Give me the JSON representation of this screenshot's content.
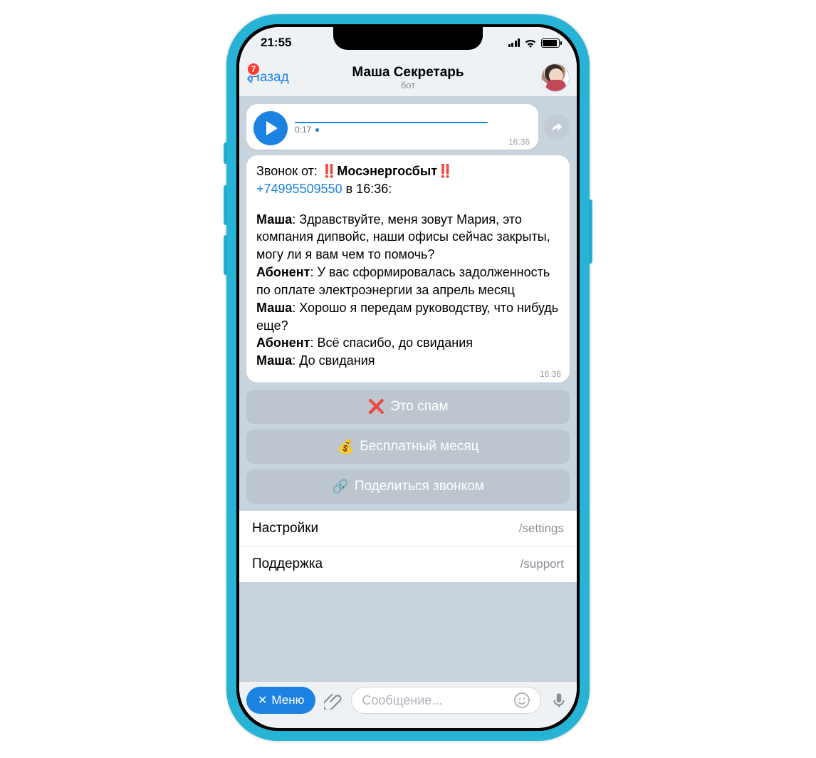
{
  "statusbar": {
    "time": "21:55"
  },
  "navbar": {
    "back_label": "Назад",
    "badge_count": "7",
    "title": "Маша Секретарь",
    "subtitle": "бот"
  },
  "voice_message": {
    "duration": "0:17",
    "time": "16:36"
  },
  "call_transcript": {
    "header_prefix": "Звонок от: ",
    "caller_name": "Мосэнергосбыт",
    "phone": "+74995509550",
    "at_word": " в ",
    "call_time": "16:36",
    "msg_time": "16:36",
    "lines": [
      {
        "speaker": "Маша",
        "text": "Здравствуйте, меня зовут Мария, это компания дипвойс, наши офисы сейчас закрыты, могу ли я вам чем то помочь?"
      },
      {
        "speaker": "Абонент",
        "text": "У вас сформировалась задолженность по оплате электроэнергии за апрель месяц"
      },
      {
        "speaker": "Маша",
        "text": "Хорошо я передам руководству, что нибудь еще?"
      },
      {
        "speaker": "Абонент",
        "text": "Всё спасибо, до свидания"
      },
      {
        "speaker": "Маша",
        "text": "До свидания"
      }
    ]
  },
  "inline_buttons": {
    "spam": "Это спам",
    "free_month": "Бесплатный месяц",
    "share_call": "Поделиться звонком"
  },
  "commands": [
    {
      "label": "Настройки",
      "cmd": "/settings"
    },
    {
      "label": "Поддержка",
      "cmd": "/support"
    }
  ],
  "inputbar": {
    "menu_label": "Меню",
    "placeholder": "Сообщение..."
  },
  "emojis": {
    "bangbang": "‼️",
    "cross": "❌",
    "money": "💰",
    "link": "🔗"
  }
}
